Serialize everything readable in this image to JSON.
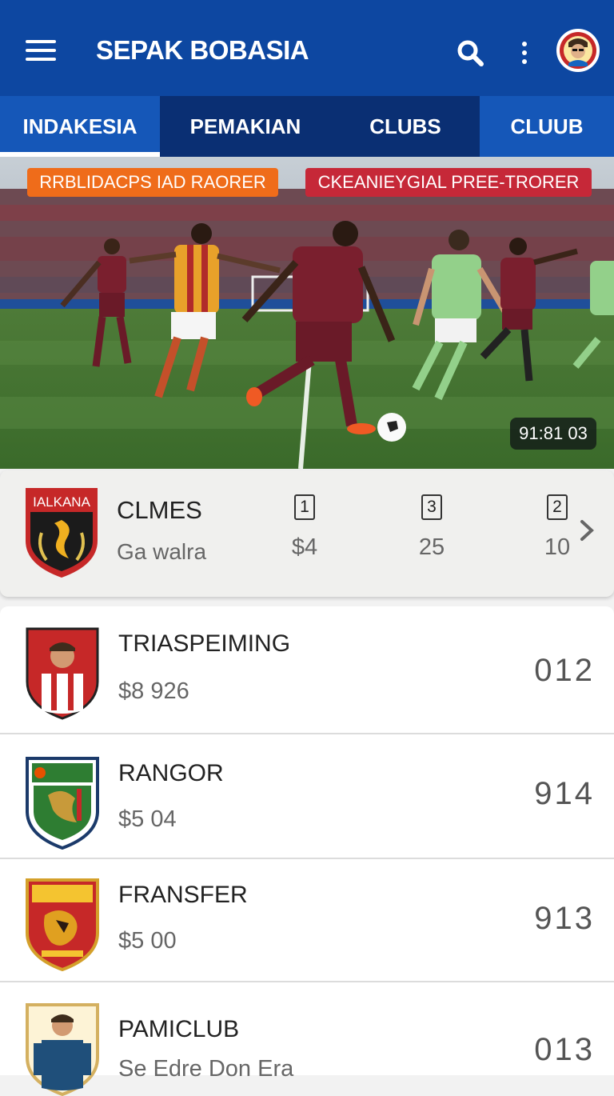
{
  "app": {
    "title": "SEPAK BOBASIA"
  },
  "icons": {
    "menu": "menu-icon",
    "search": "search-icon",
    "more": "more-vert-icon",
    "avatar": "avatar-icon"
  },
  "colors": {
    "primary": "#0d47a1",
    "tab_bar": "#0a3a8a",
    "banner_orange": "#ef6c1a",
    "banner_red": "#c62838"
  },
  "tabs": [
    {
      "label": "INDAKESIA",
      "active": true
    },
    {
      "label": "PEMAKIAN"
    },
    {
      "label": "CLUBS"
    },
    {
      "label": "CLUUB"
    }
  ],
  "hero": {
    "banner_left": "RRBLIDACPS IAD RAORER",
    "banner_right": "CKEANIEYGIAL PREE-TRORER",
    "timer": "91:81 03"
  },
  "summary": {
    "crest_text": "IALKANA",
    "title": "CLMES",
    "subtitle": "Ga walra",
    "stats": [
      {
        "badge": "1",
        "value": "$4"
      },
      {
        "badge": "3",
        "value": "25"
      },
      {
        "badge": "2",
        "value": "10"
      }
    ]
  },
  "list": [
    {
      "name": "TRIASPEIMING",
      "price": "$8 926",
      "number": "012"
    },
    {
      "name": "RANGOR",
      "price": "$5 04",
      "number": "914"
    },
    {
      "name": "FRANSFER",
      "price": "$5 00",
      "number": "913"
    },
    {
      "name": "PAMICLUB",
      "price": "Se Edre Don Era",
      "number": "013"
    }
  ]
}
